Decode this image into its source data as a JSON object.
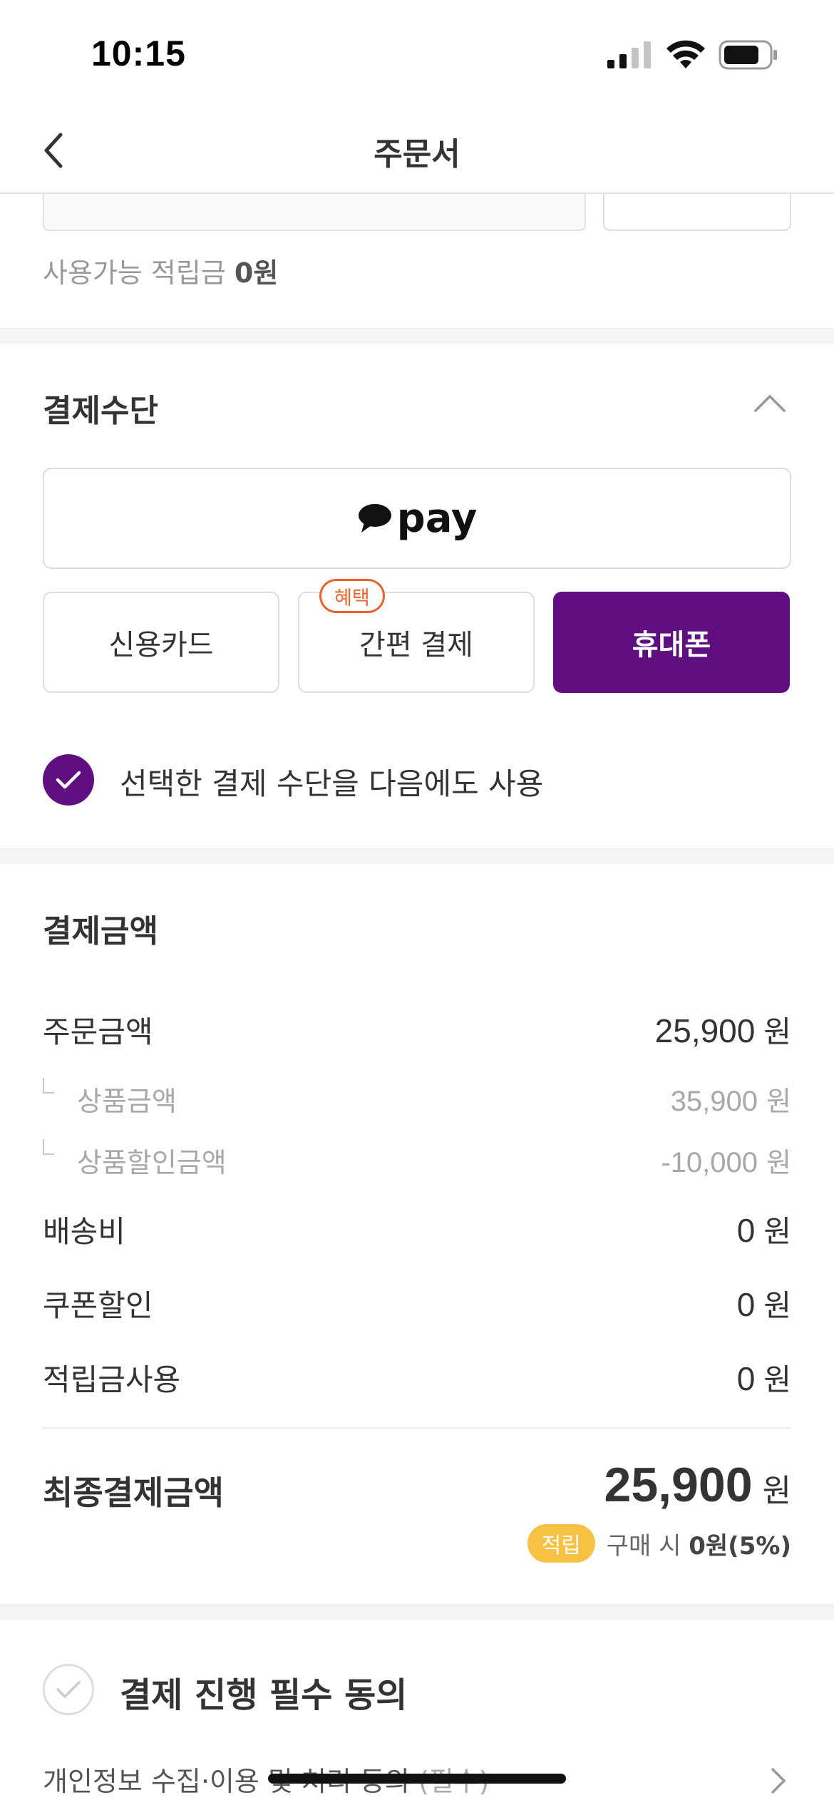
{
  "status_bar": {
    "time": "10:15",
    "icons": [
      "signal-icon",
      "wifi-icon",
      "battery-icon"
    ]
  },
  "header": {
    "back_icon": "chevron-left-icon",
    "title": "주문서"
  },
  "points": {
    "available_prefix": "사용가능 적립금",
    "available_value": "0원"
  },
  "payment_method": {
    "title": "결제수단",
    "collapse_icon": "chevron-up-icon",
    "kakaopay_label": "pay",
    "methods": [
      {
        "label": "신용카드",
        "selected": false
      },
      {
        "label": "간편 결제",
        "selected": false,
        "badge": "혜택"
      },
      {
        "label": "휴대폰",
        "selected": true
      }
    ],
    "remember_label": "선택한 결제 수단을 다음에도 사용",
    "remember_checked": true
  },
  "amount": {
    "title": "결제금액",
    "unit": "원",
    "rows": [
      {
        "label": "주문금액",
        "value": "25,900"
      },
      {
        "label": "상품금액",
        "value": "35,900",
        "sub": true
      },
      {
        "label": "상품할인금액",
        "value": "-10,000",
        "sub": true
      },
      {
        "label": "배송비",
        "value": "0"
      },
      {
        "label": "쿠폰할인",
        "value": "0"
      },
      {
        "label": "적립금사용",
        "value": "0"
      }
    ],
    "final_label": "최종결제금액",
    "final_value": "25,900",
    "reward_badge": "적립",
    "reward_prefix": "구매 시",
    "reward_value": "0원(5%)"
  },
  "agreement": {
    "title": "결제 진행 필수 동의",
    "item_label": "개인정보 수집·이용 및 처리 동의",
    "item_required": "(필수)"
  },
  "colors": {
    "primary": "#5f0f80",
    "benefit": "#e9642d",
    "reward": "#f7c244"
  }
}
